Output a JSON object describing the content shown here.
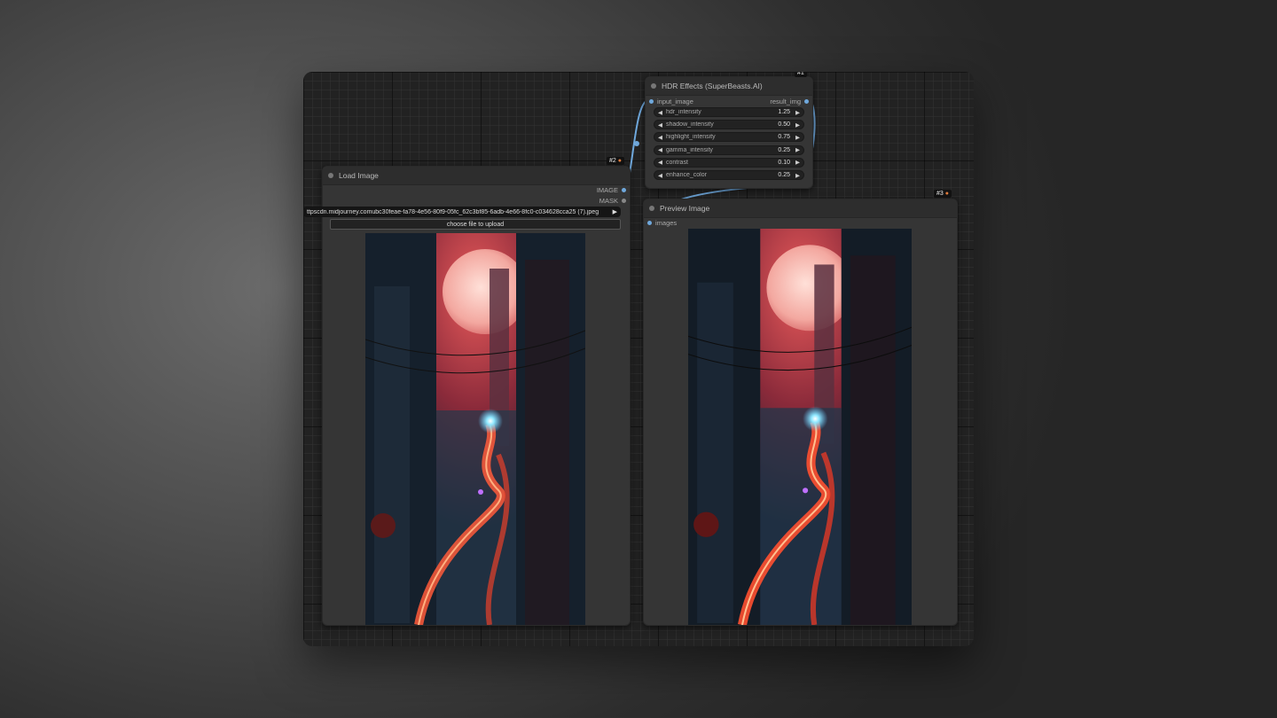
{
  "nodes": {
    "hdr": {
      "title": "HDR Effects (SuperBeasts.AI)",
      "id_badge": "#1",
      "input_label": "input_image",
      "output_label": "result_img",
      "widgets": [
        {
          "label": "hdr_intensity",
          "value": "1.25"
        },
        {
          "label": "shadow_intensity",
          "value": "0.50"
        },
        {
          "label": "highlight_intensity",
          "value": "0.75"
        },
        {
          "label": "gamma_intensity",
          "value": "0.25"
        },
        {
          "label": "contrast",
          "value": "0.10"
        },
        {
          "label": "enhance_color",
          "value": "0.25"
        }
      ]
    },
    "load": {
      "title": "Load Image",
      "id_badge": "#2",
      "output_image": "IMAGE",
      "output_mask": "MASK",
      "image_combo": "ttpscdn.midjourney.comubc30feae-fa78-4e56-80f9-05fc_62c3bf85-6adb-4e66-8fc0-c034628cca25 (7).jpeg",
      "upload_label": "choose file to upload"
    },
    "preview": {
      "title": "Preview Image",
      "id_badge": "#3",
      "input_label": "images"
    }
  },
  "colors": {
    "link": "#6fa8dc",
    "node_bg": "#353535",
    "title_bg": "#2d2d2d"
  }
}
